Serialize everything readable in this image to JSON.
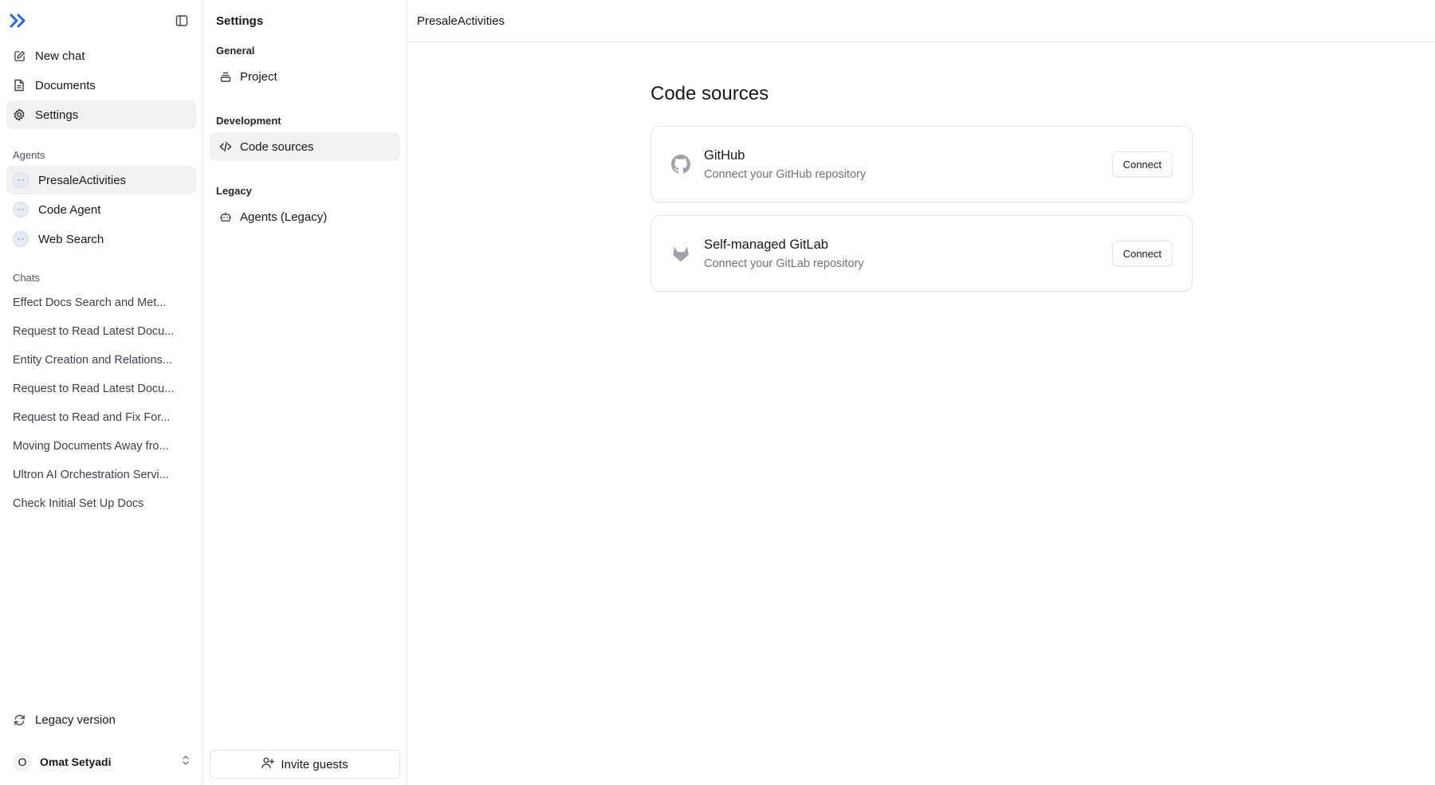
{
  "sidebar": {
    "logo_icon": "double-chevron-right-icon",
    "toggle_icon": "sidebar-toggle-icon",
    "nav": [
      {
        "label": "New chat",
        "icon": "edit-icon"
      },
      {
        "label": "Documents",
        "icon": "document-icon"
      },
      {
        "label": "Settings",
        "icon": "gear-icon",
        "active": true
      }
    ],
    "agents_label": "Agents",
    "agents": [
      {
        "label": "PresaleActivities",
        "active": true
      },
      {
        "label": "Code Agent"
      },
      {
        "label": "Web Search"
      }
    ],
    "chats_label": "Chats",
    "chats": [
      "Effect Docs Search and Met...",
      "Request to Read Latest Docu...",
      "Entity Creation and Relations...",
      "Request to Read Latest Docu...",
      "Request to Read and Fix For...",
      "Moving Documents Away fro...",
      "Ultron AI Orchestration Servi...",
      "Check Initial Set Up Docs"
    ],
    "legacy_label": "Legacy version",
    "user": {
      "initial": "O",
      "name": "Omat Setyadi"
    }
  },
  "settings": {
    "title": "Settings",
    "groups": [
      {
        "label": "General",
        "items": [
          {
            "label": "Project",
            "icon": "layers-icon"
          }
        ]
      },
      {
        "label": "Development",
        "items": [
          {
            "label": "Code sources",
            "icon": "code-icon",
            "active": true
          }
        ]
      },
      {
        "label": "Legacy",
        "items": [
          {
            "label": "Agents (Legacy)",
            "icon": "bot-icon"
          }
        ]
      }
    ],
    "invite_label": "Invite guests"
  },
  "main": {
    "breadcrumb": "PresaleActivities",
    "title": "Code sources",
    "sources": [
      {
        "name": "GitHub",
        "desc": "Connect your GitHub repository",
        "button": "Connect",
        "icon": "github-icon"
      },
      {
        "name": "Self-managed GitLab",
        "desc": "Connect your GitLab repository",
        "button": "Connect",
        "icon": "gitlab-icon"
      }
    ]
  },
  "colors": {
    "accent": "#2563eb",
    "border": "#e4e4e7",
    "active_bg": "#f1f1f2",
    "muted_text": "#71717a"
  }
}
